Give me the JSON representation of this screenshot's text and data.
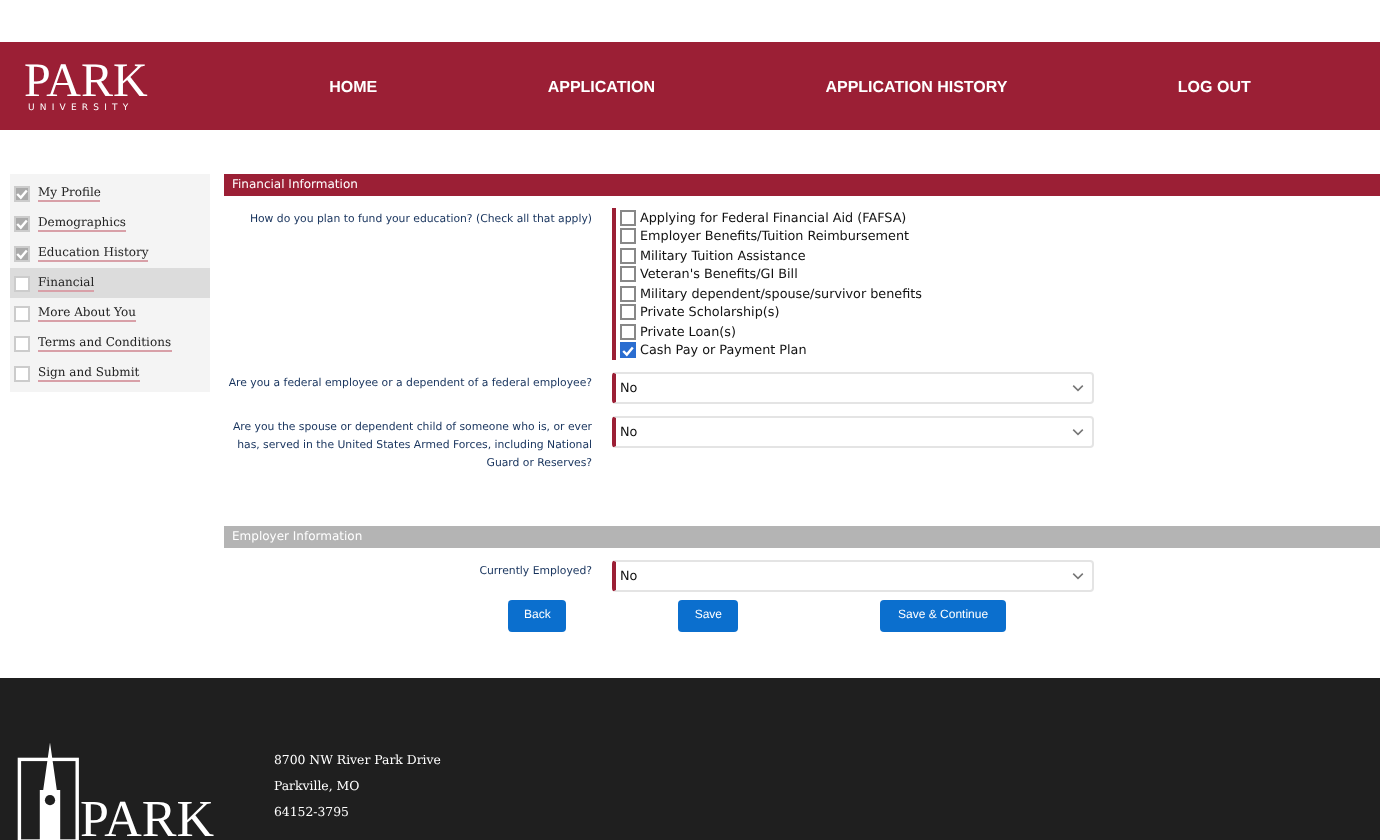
{
  "header": {
    "logo": {
      "name": "PARK",
      "subtitle": "UNIVERSITY"
    },
    "nav": [
      "HOME",
      "APPLICATION",
      "APPLICATION HISTORY",
      "LOG OUT"
    ]
  },
  "sidebar": {
    "items": [
      {
        "label": "My Profile",
        "checked": true,
        "selected": false
      },
      {
        "label": "Demographics",
        "checked": true,
        "selected": false
      },
      {
        "label": "Education History",
        "checked": true,
        "selected": false
      },
      {
        "label": "Financial",
        "checked": false,
        "selected": true
      },
      {
        "label": "More About You",
        "checked": false,
        "selected": false
      },
      {
        "label": "Terms and Conditions",
        "checked": false,
        "selected": false
      },
      {
        "label": "Sign and Submit",
        "checked": false,
        "selected": false
      }
    ]
  },
  "financial": {
    "title": "Financial Information",
    "funding": {
      "question": "How do you plan to fund your education? (Check all that apply)",
      "options": [
        {
          "label": "Applying for Federal Financial Aid (FAFSA)",
          "checked": false
        },
        {
          "label": "Employer Benefits/Tuition Reimbursement",
          "checked": false
        },
        {
          "label": "Military Tuition Assistance",
          "checked": false
        },
        {
          "label": "Veteran's Benefits/GI Bill",
          "checked": false
        },
        {
          "label": "Military dependent/spouse/survivor benefits",
          "checked": false
        },
        {
          "label": "Private Scholarship(s)",
          "checked": false
        },
        {
          "label": "Private Loan(s)",
          "checked": false
        },
        {
          "label": "Cash Pay or Payment Plan",
          "checked": true
        }
      ]
    },
    "questions": [
      {
        "label": "Are you a federal employee or a dependent of a federal employee?",
        "value": "No"
      },
      {
        "label": "Are you the spouse or dependent child of someone who is, or ever has, served in the United States Armed Forces, including National Guard or Reserves?",
        "value": "No"
      }
    ]
  },
  "employer": {
    "title": "Employer Information",
    "questions": [
      {
        "label": "Currently Employed?",
        "value": "No"
      }
    ]
  },
  "buttons": [
    "Back",
    "Save",
    "Save & Continue"
  ],
  "footer": {
    "logo": "PARK",
    "address": [
      "8700 NW River Park Drive",
      "Parkville, MO",
      "64152-3795"
    ]
  }
}
